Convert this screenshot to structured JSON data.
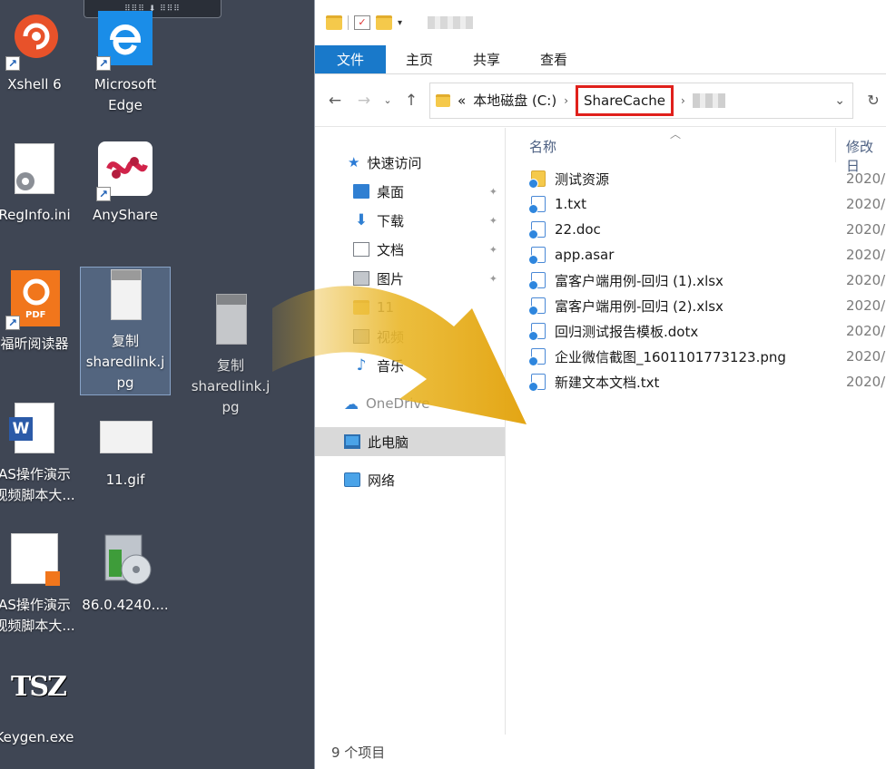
{
  "mini_toolbar": {
    "glyph": "⠿⠿⠿ ⬇ ⠿⠿⠿"
  },
  "desktop": {
    "icons": [
      {
        "id": "xshell",
        "label": "Xshell 6"
      },
      {
        "id": "edge",
        "label": "Microsoft\nEdge"
      },
      {
        "id": "reginfo",
        "label": "RegInfo.ini"
      },
      {
        "id": "anyshare",
        "label": "AnyShare"
      },
      {
        "id": "foxit",
        "label": "福昕阅读器"
      },
      {
        "id": "copy-selected",
        "label": "复制\nsharedlink.j\npg"
      },
      {
        "id": "copy-drag",
        "label": "复制\nsharedlink.j\npg"
      },
      {
        "id": "word1",
        "label": "AS操作演示\n视频脚本大..."
      },
      {
        "id": "gif",
        "label": "11.gif"
      },
      {
        "id": "pdf2",
        "label": "AS操作演示\n视频脚本大..."
      },
      {
        "id": "chrome-setup",
        "label": "86.0.4240...."
      },
      {
        "id": "keygen",
        "label": "Keygen.exe"
      }
    ],
    "badges": {
      "pdf": "PDF",
      "word": "W",
      "tsz": "TSZ"
    }
  },
  "explorer": {
    "ribbon": {
      "file": "文件",
      "home": "主页",
      "share": "共享",
      "view": "查看"
    },
    "address": {
      "prefix": "«",
      "drive": "本地磁盘 (C:)",
      "sep": "›",
      "folder": "ShareCache"
    },
    "nav": {
      "quick_access": "快速访问",
      "desktop": "桌面",
      "downloads": "下载",
      "documents": "文档",
      "pictures": "图片",
      "folder_11": "11",
      "videos": "视频",
      "music": "音乐",
      "onedrive": "OneDrive",
      "this_pc": "此电脑",
      "network": "网络"
    },
    "columns": {
      "name": "名称",
      "date": "修改日"
    },
    "files": [
      {
        "name": "测试资源",
        "date": "2020/",
        "type": "folder"
      },
      {
        "name": "1.txt",
        "date": "2020/",
        "type": "file"
      },
      {
        "name": "22.doc",
        "date": "2020/",
        "type": "file"
      },
      {
        "name": "app.asar",
        "date": "2020/",
        "type": "file"
      },
      {
        "name": "富客户端用例-回归 (1).xlsx",
        "date": "2020/",
        "type": "file"
      },
      {
        "name": "富客户端用例-回归 (2).xlsx",
        "date": "2020/",
        "type": "file"
      },
      {
        "name": "回归测试报告模板.dotx",
        "date": "2020/",
        "type": "file"
      },
      {
        "name": "企业微信截图_1601101773123.png",
        "date": "2020/",
        "type": "file"
      },
      {
        "name": "新建文本文档.txt",
        "date": "2020/",
        "type": "file"
      }
    ],
    "status": "9 个项目"
  },
  "colors": {
    "ribbon_file": "#1979ca",
    "highlight": "#e0201b",
    "arrow": "#e8b21c",
    "desktop": "#3f4654"
  }
}
